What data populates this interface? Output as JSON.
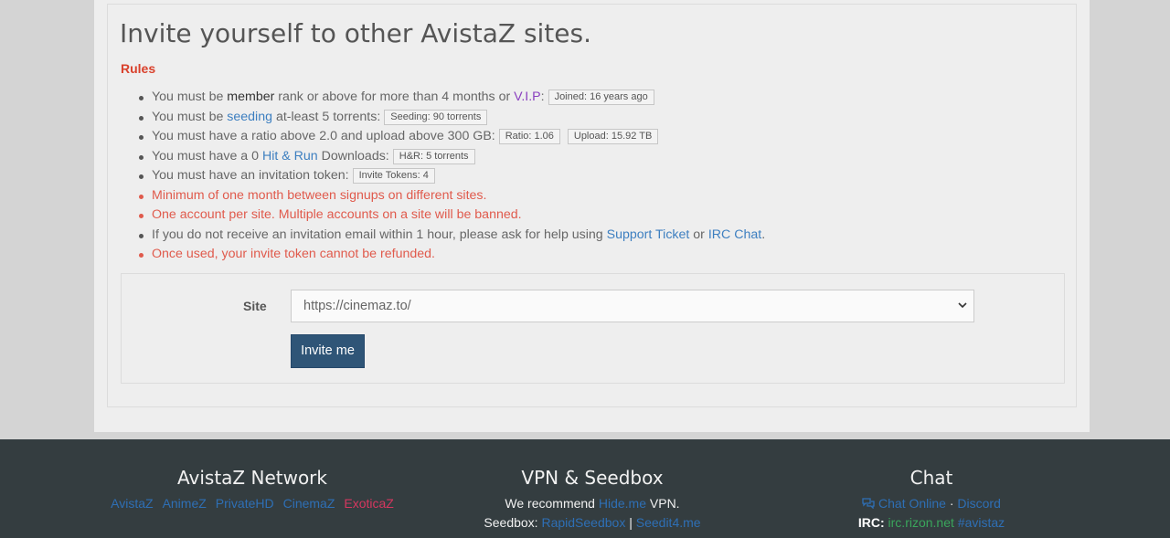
{
  "title": "Invite yourself to other AvistaZ sites.",
  "rules_heading": "Rules",
  "rules": {
    "r1": {
      "pre": "You must be ",
      "k": "member",
      "mid": " rank or above for more than 4 months or ",
      "link": "V.I.P",
      "post": ":",
      "badge": "Joined: 16 years ago"
    },
    "r2": {
      "pre": "You must be ",
      "link": "seeding",
      "post": " at-least 5 torrents:",
      "badge": "Seeding: 90 torrents"
    },
    "r3": {
      "text": "You must have a ratio above 2.0 and upload above 300 GB:",
      "badge1": "Ratio: 1.06",
      "badge2": "Upload: 15.92 TB"
    },
    "r4": {
      "pre": "You must have a 0 ",
      "link": "Hit & Run",
      "post": " Downloads:",
      "badge": "H&R: 5 torrents"
    },
    "r5": {
      "text": "You must have an invitation token:",
      "badge": "Invite Tokens: 4"
    },
    "r6": {
      "text": "Minimum of one month between signups on different sites."
    },
    "r7": {
      "text": "One account per site. Multiple accounts on a site will be banned."
    },
    "r8": {
      "pre": "If you do not receive an invitation email within 1 hour, please ask for help using ",
      "link1": "Support Ticket",
      "mid": " or ",
      "link2": "IRC Chat",
      "post": "."
    },
    "r9": {
      "text": "Once used, your invite token cannot be refunded."
    }
  },
  "form": {
    "site_label": "Site",
    "site_value": "https://cinemaz.to/",
    "button": "Invite me"
  },
  "footer": {
    "network": {
      "heading": "AvistaZ Network",
      "links": [
        "AvistaZ",
        "AnimeZ",
        "PrivateHD",
        "CinemaZ",
        "ExoticaZ"
      ]
    },
    "vpn": {
      "heading": "VPN & Seedbox",
      "recommend_pre": "We recommend ",
      "recommend_link": "Hide.me",
      "recommend_post": " VPN.",
      "seedbox_pre": "Seedbox: ",
      "seedbox_link1": "RapidSeedbox",
      "sep": " | ",
      "seedbox_link2": "Seedit4.me"
    },
    "chat": {
      "heading": "Chat",
      "chat_online": "Chat Online",
      "dot": " · ",
      "discord": "Discord",
      "irc_label": "IRC:",
      "irc_server": "irc.rizon.net",
      "irc_channel": "#avistaz"
    }
  },
  "icons": {
    "chat": "chat-bubbles-icon",
    "select": "chevron-down-icon"
  },
  "colors": {
    "warning": "#e05a4c",
    "link": "#3d7fc0",
    "vip": "#8a3fbf",
    "button": "#2f5577",
    "footer_bg": "#343d40",
    "exoticaz": "#d5375f",
    "irc": "#3aa55b"
  }
}
